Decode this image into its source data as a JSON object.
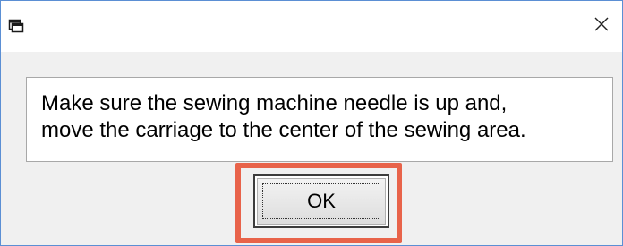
{
  "window": {
    "icon": "app-window-icon",
    "close_icon": "close-icon"
  },
  "message": {
    "line1": "Make sure the sewing machine needle is up and,",
    "line2": "move the carriage to the center of the sewing area."
  },
  "buttons": {
    "ok_label": "OK"
  },
  "colors": {
    "highlight": "#e8634a",
    "window_border": "#5b8fd4",
    "client_bg": "#f0f0f0"
  }
}
